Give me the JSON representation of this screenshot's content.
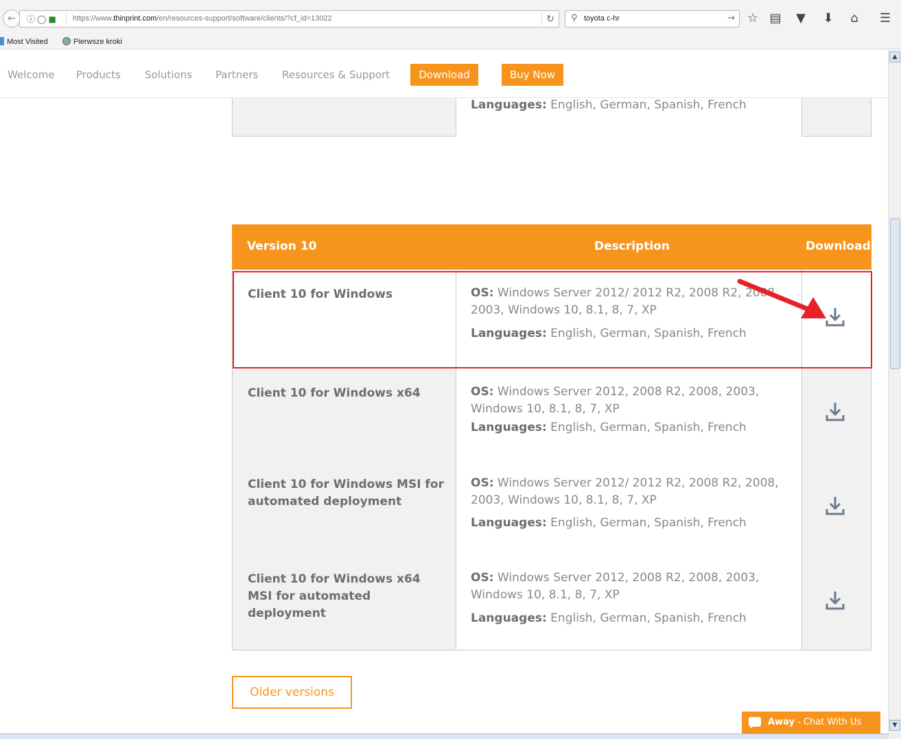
{
  "browser": {
    "url_prefix": "https://www.",
    "url_domain": "thinprint.com",
    "url_path": "/en/resources-support/software/clients/?cf_id=13022",
    "search_query": "toyota c-hr",
    "bookmarks": [
      "Most Visited",
      "Pierwsze kroki"
    ]
  },
  "nav": {
    "items": [
      "Welcome",
      "Products",
      "Solutions",
      "Partners",
      "Resources & Support"
    ],
    "download_label": "Download",
    "buy_label": "Buy Now"
  },
  "prev_table": {
    "languages_label": "Languages:",
    "languages_value": "English, German, Spanish, French"
  },
  "table": {
    "headers": [
      "Version 10",
      "Description",
      "Download"
    ],
    "rows": [
      {
        "name": "Client 10 for Windows",
        "os_label": "OS:",
        "os_value": "Windows Server 2012/ 2012 R2, 2008 R2, 2008, 2003, Windows 10, 8.1, 8, 7, XP",
        "lang_label": "Languages:",
        "lang_value": "English, German, Spanish, French"
      },
      {
        "name": "Client 10 for Windows x64",
        "os_label": "OS:",
        "os_value": "Windows Server 2012, 2008 R2, 2008, 2003, Windows 10, 8.1, 8, 7, XP",
        "lang_label": "Languages:",
        "lang_value": "English, German, Spanish, French"
      },
      {
        "name": "Client 10 for Windows MSI for automated deployment",
        "os_label": "OS:",
        "os_value": "Windows Server 2012/ 2012 R2, 2008 R2, 2008, 2003, Windows 10, 8.1, 8, 7, XP",
        "lang_label": "Languages:",
        "lang_value": "English, German, Spanish, French"
      },
      {
        "name": "Client 10 for Windows x64 MSI for automated deployment",
        "os_label": "OS:",
        "os_value": "Windows Server 2012, 2008 R2, 2008, 2003, Windows 10, 8.1, 8, 7, XP",
        "lang_label": "Languages:",
        "lang_value": "English, German, Spanish, French"
      }
    ]
  },
  "older_label": "Older versions",
  "chat": {
    "status": "Away",
    "text": " - Chat With Us"
  },
  "colors": {
    "accent": "#f7941d",
    "annotation": "#e8202a",
    "icon": "#6b7a8a"
  },
  "icons": [
    "back-icon",
    "info-icon",
    "shield-icon",
    "lock-icon",
    "reload-icon",
    "search-icon",
    "arrow-right-icon",
    "star-icon",
    "reading-list-icon",
    "pocket-icon",
    "download-arrow-icon",
    "home-icon",
    "menu-icon",
    "download-icon",
    "chat-bubble-icon"
  ]
}
